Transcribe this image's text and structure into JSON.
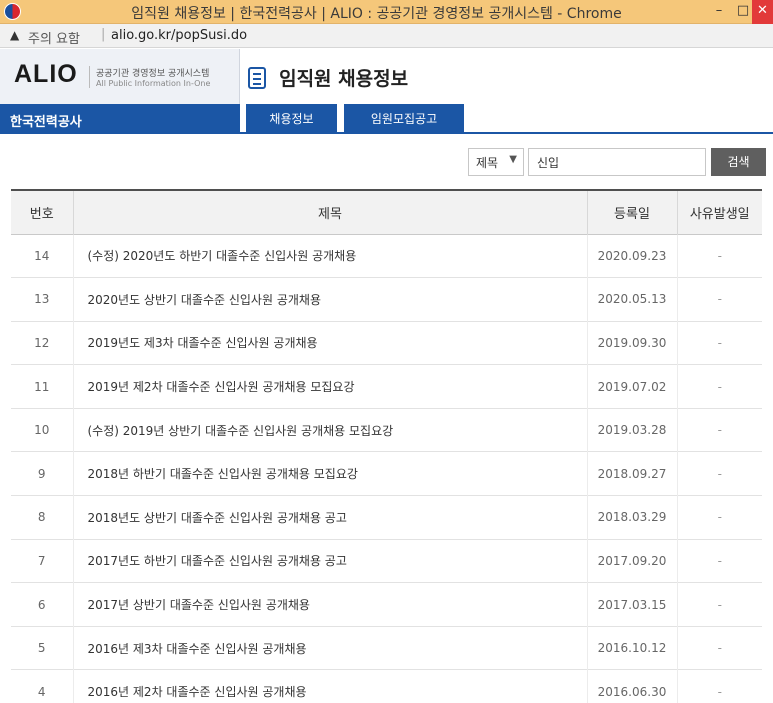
{
  "window": {
    "title": "임직원 채용정보 | 한국전력공사 | ALIO : 공공기관 경영정보 공개시스템 - Chrome",
    "min_label": "–",
    "max_label": "□",
    "close_label": "✕"
  },
  "address_bar": {
    "warning_label": "주의 요함",
    "url": "alio.go.kr/popSusi.do"
  },
  "brand": {
    "logo": "ALIO",
    "subtitle_ko": "공공기관 경영정보 공개시스템",
    "subtitle_en": "All Public Information In-One"
  },
  "page": {
    "title": "임직원 채용정보",
    "company": "한국전력공사"
  },
  "tabs": [
    {
      "label": "채용정보"
    },
    {
      "label": "임원모집공고"
    }
  ],
  "search": {
    "field_option": "제목",
    "query": "신입",
    "button_label": "검색"
  },
  "table": {
    "headers": {
      "num": "번호",
      "title": "제목",
      "date": "등록일",
      "issue": "사유발생일"
    },
    "rows": [
      {
        "num": "14",
        "title": "(수정) 2020년도 하반기 대졸수준 신입사원 공개채용",
        "date": "2020.09.23",
        "issue": "-"
      },
      {
        "num": "13",
        "title": "2020년도 상반기 대졸수준 신입사원 공개채용",
        "date": "2020.05.13",
        "issue": "-"
      },
      {
        "num": "12",
        "title": "2019년도 제3차 대졸수준 신입사원 공개채용",
        "date": "2019.09.30",
        "issue": "-"
      },
      {
        "num": "11",
        "title": "2019년 제2차 대졸수준 신입사원 공개채용 모집요강",
        "date": "2019.07.02",
        "issue": "-"
      },
      {
        "num": "10",
        "title": "(수정) 2019년 상반기 대졸수준 신입사원 공개채용 모집요강",
        "date": "2019.03.28",
        "issue": "-"
      },
      {
        "num": "9",
        "title": "2018년 하반기 대졸수준 신입사원 공개채용 모집요강",
        "date": "2018.09.27",
        "issue": "-"
      },
      {
        "num": "8",
        "title": "2018년도 상반기 대졸수준 신입사원 공개채용 공고",
        "date": "2018.03.29",
        "issue": "-"
      },
      {
        "num": "7",
        "title": "2017년도 하반기 대졸수준 신입사원 공개채용 공고",
        "date": "2017.09.20",
        "issue": "-"
      },
      {
        "num": "6",
        "title": "2017년 상반기 대졸수준 신입사원 공개채용",
        "date": "2017.03.15",
        "issue": "-"
      },
      {
        "num": "5",
        "title": "2016년 제3차 대졸수준 신입사원 공개채용",
        "date": "2016.10.12",
        "issue": "-"
      },
      {
        "num": "4",
        "title": "2016년 제2차 대졸수준 신입사원 공개채용",
        "date": "2016.06.30",
        "issue": "-"
      }
    ]
  }
}
